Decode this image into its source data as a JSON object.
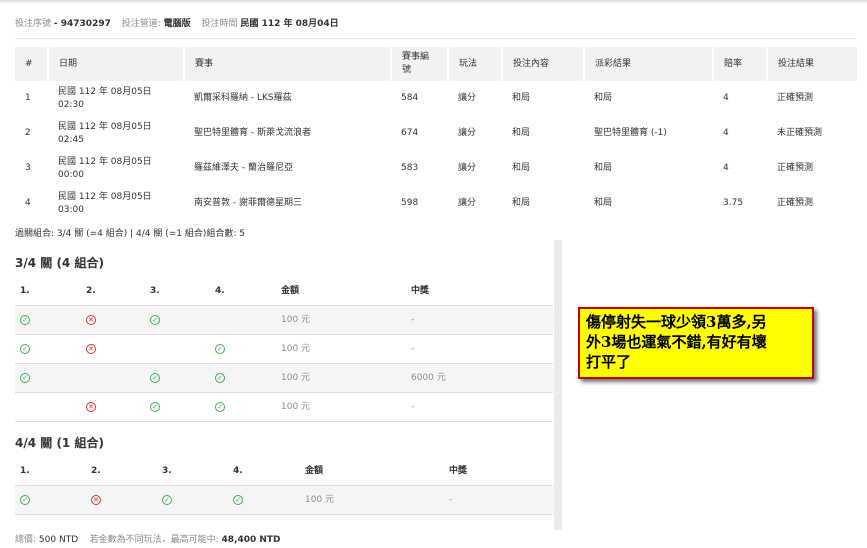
{
  "header": {
    "bet_no_label": "投注序號",
    "bet_no_value": "- 94730297",
    "platform_label": "投注管道:",
    "platform_value": "電腦版",
    "time_label": "投注時間",
    "time_value": "民國 112 年 08月04日"
  },
  "table": {
    "headers": [
      "#",
      "日期",
      "賽事",
      "賽事編號",
      "玩法",
      "投注內容",
      "派彩結果",
      "賠率",
      "投注結果"
    ],
    "rows": [
      {
        "no": "1",
        "date": "民國 112 年 08月05日",
        "time": "02:30",
        "match": "凱爾采科羅納 - LKS羅茲",
        "match_no": "584",
        "play": "讓分",
        "bet": "和局",
        "result": "和局",
        "odds": "4",
        "outcome": "正確預測"
      },
      {
        "no": "2",
        "date": "民國 112 年 08月05日",
        "time": "02:45",
        "match": "聖巴特里體育 - 斯萊戈流浪者",
        "match_no": "674",
        "play": "讓分",
        "bet": "和局",
        "result": "聖巴特里體育 (-1)",
        "odds": "4",
        "outcome": "未正確預測"
      },
      {
        "no": "3",
        "date": "民國 112 年 08月05日",
        "time": "00:00",
        "match": "羅茲維澤夫 - 蘭治羅尼亞",
        "match_no": "583",
        "play": "讓分",
        "bet": "和局",
        "result": "和局",
        "odds": "4",
        "outcome": "正確預測"
      },
      {
        "no": "4",
        "date": "民國 112 年 08月05日",
        "time": "03:00",
        "match": "南安普敦 - 謝菲爾德星期三",
        "match_no": "598",
        "play": "讓分",
        "bet": "和局",
        "result": "和局",
        "odds": "3.75",
        "outcome": "正確預測"
      }
    ]
  },
  "summary": "過關組合: 3/4 關 (=4 組合) | 4/4 關 (=1 組合)組合數: 5",
  "combo34": {
    "title": "3/4 關 (4 組合)",
    "headers": [
      "1.",
      "2.",
      "3.",
      "4.",
      "金額",
      "中獎"
    ],
    "rows": [
      {
        "c1": "ok",
        "c2": "no",
        "c3": "ok",
        "c4": "",
        "amount": "100 元",
        "prize": "-"
      },
      {
        "c1": "ok",
        "c2": "no",
        "c3": "",
        "c4": "ok",
        "amount": "100 元",
        "prize": "-"
      },
      {
        "c1": "ok",
        "c2": "",
        "c3": "ok",
        "c4": "ok",
        "amount": "100 元",
        "prize": "6000 元"
      },
      {
        "c1": "",
        "c2": "no",
        "c3": "ok",
        "c4": "ok",
        "amount": "100 元",
        "prize": "-"
      }
    ]
  },
  "combo44": {
    "title": "4/4 關 (1 組合)",
    "headers": [
      "1.",
      "2.",
      "3.",
      "4.",
      "金額",
      "中獎"
    ],
    "rows": [
      {
        "c1": "ok",
        "c2": "no",
        "c3": "ok",
        "c4": "ok",
        "amount": "100 元",
        "prize": "-"
      }
    ]
  },
  "footer": {
    "total_label": "總價:",
    "total_value": "500 NTD",
    "note_label": "若金數為不同玩法，最高可能中:",
    "max_value": "48,400 NTD"
  },
  "annotation": {
    "line1": "傷停射失一球少領3萬多,另",
    "line2": "外3場也運氣不錯,有好有壞",
    "line3": "打平了"
  },
  "colors": {
    "ok": "#3bb34a",
    "no": "#d9362b",
    "note_bg": "#ffff00",
    "note_border": "#c40000"
  },
  "icons": {
    "ok": "check-circle-icon",
    "no": "x-circle-icon"
  }
}
